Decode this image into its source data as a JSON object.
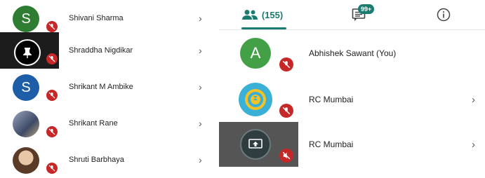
{
  "left_list": [
    {
      "name": "Shivani Sharma",
      "avatar_letter": "S",
      "avatar_color": "#2e7d32",
      "tile_bg": "#ffffff"
    },
    {
      "name": "Shraddha Nigdikar",
      "avatar_letter": "",
      "avatar_color": "#000000",
      "tile_bg": "#1c1c1c",
      "avatar_icon": "pin-icon"
    },
    {
      "name": "Shrikant M Ambike",
      "avatar_letter": "S",
      "avatar_color": "#1e5ea8",
      "tile_bg": "#ffffff"
    },
    {
      "name": "Shrikant Rane",
      "avatar_letter": "",
      "avatar_color": "#5d6f8a",
      "tile_bg": "#ffffff",
      "avatar_icon": "photo-avatar"
    },
    {
      "name": "Shruti Barbhaya",
      "avatar_letter": "",
      "avatar_color": "#8b6a4f",
      "tile_bg": "#ffffff",
      "avatar_icon": "photo-avatar"
    }
  ],
  "tabs": {
    "people_count": "(155)",
    "chat_badge": "99+",
    "active": "people",
    "accent": "#1a7c70"
  },
  "right_list": [
    {
      "name": "Abhishek Sawant (You)",
      "avatar_letter": "A",
      "avatar_color": "#43a047",
      "tile_bg": "#ffffff",
      "chevron": false
    },
    {
      "name": "RC Mumbai",
      "avatar_letter": "",
      "avatar_color": "#3ab0d6",
      "tile_bg": "#ffffff",
      "avatar_icon": "rotary-logo",
      "chevron": true
    },
    {
      "name": "RC Mumbai",
      "avatar_letter": "",
      "avatar_color": "#2f3d40",
      "tile_bg": "#555555",
      "avatar_icon": "screen-share-icon",
      "chevron": true
    }
  ],
  "mic_color": "#c62828"
}
